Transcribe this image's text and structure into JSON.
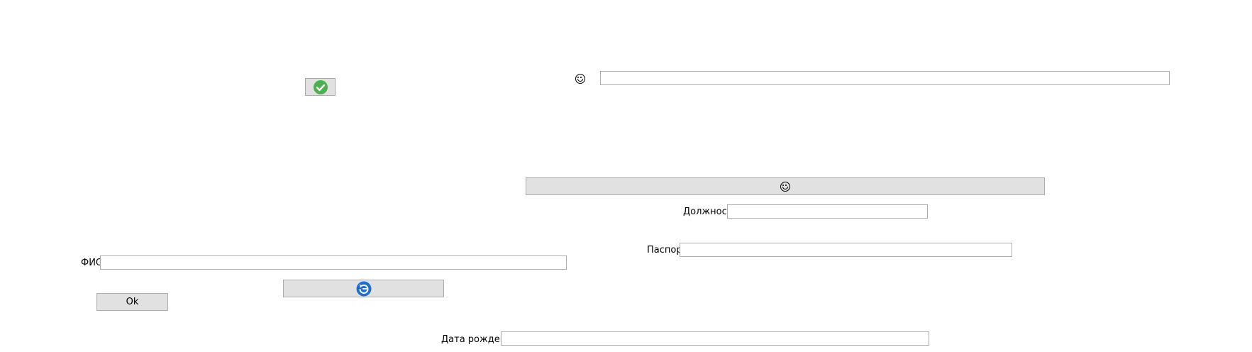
{
  "labels": {
    "fio": "ФИО",
    "position": "Должность",
    "passport": "Паспорт",
    "birth_date": "Дата рождения"
  },
  "buttons": {
    "ok": "Ok"
  },
  "fields": {
    "top": "",
    "fio": "",
    "position": "",
    "passport": "",
    "birth_date": ""
  },
  "icons": {
    "confirm": "check-circle-icon",
    "action": "emoji-icon",
    "refresh": "refresh-icon"
  },
  "colors": {
    "check_green": "#4caf50",
    "refresh_blue": "#1e6fd0",
    "button_bg": "#e1e1e1",
    "border": "#adadad"
  }
}
